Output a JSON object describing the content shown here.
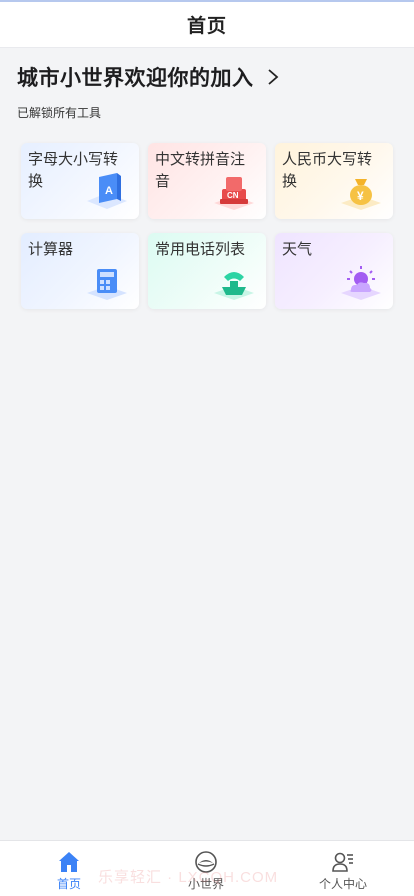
{
  "header": {
    "title": "首页"
  },
  "welcome": {
    "text": "城市小世界欢迎你的加入",
    "icon": "chevron-right-icon"
  },
  "subtitle": "已解锁所有工具",
  "tools": [
    {
      "label": "字母大小写转换",
      "icon": "letter-a-icon",
      "accent": "#3b82f6"
    },
    {
      "label": "中文转拼音注音",
      "icon": "cn-stamp-icon",
      "accent": "#ef4444"
    },
    {
      "label": "人民币大写转换",
      "icon": "money-bag-icon",
      "accent": "#f5b82e"
    },
    {
      "label": "计算器",
      "icon": "calculator-icon",
      "accent": "#3b82f6"
    },
    {
      "label": "常用电话列表",
      "icon": "phone-icon",
      "accent": "#22c59a"
    },
    {
      "label": "天气",
      "icon": "weather-icon",
      "accent": "#a855f7"
    }
  ],
  "tabbar": [
    {
      "label": "首页",
      "icon": "home-icon",
      "active": true
    },
    {
      "label": "小世界",
      "icon": "planet-icon",
      "active": false
    },
    {
      "label": "个人中心",
      "icon": "user-list-icon",
      "active": false
    }
  ],
  "watermark": "乐享轻汇 · LXCQH.COM",
  "colors": {
    "accent": "#3b82f6",
    "background": "#f3f4f6"
  }
}
